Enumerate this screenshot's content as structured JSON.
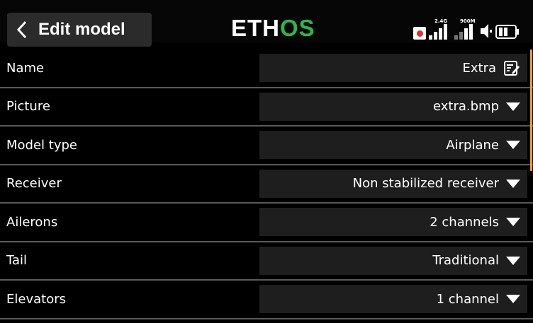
{
  "header": {
    "title": "Edit model",
    "logo_part1": "ETH",
    "logo_part2": "OS",
    "logo_part3": "",
    "signal_2g4_label": "2.4G",
    "signal_900m_label": "900M"
  },
  "colors": {
    "accent_green": "#2db64a",
    "scrollbar": "#e6a230",
    "record_red": "#e52d2d"
  },
  "rows": [
    {
      "label": "Name",
      "value": "Extra",
      "control": "edit-icon"
    },
    {
      "label": "Picture",
      "value": "extra.bmp",
      "control": "dropdown"
    },
    {
      "label": "Model type",
      "value": "Airplane",
      "control": "dropdown"
    },
    {
      "label": "Receiver",
      "value": "Non stabilized receiver",
      "control": "dropdown"
    },
    {
      "label": "Ailerons",
      "value": "2 channels",
      "control": "dropdown"
    },
    {
      "label": "Tail",
      "value": "Traditional",
      "control": "dropdown"
    },
    {
      "label": "Elevators",
      "value": "1 channel",
      "control": "dropdown"
    }
  ]
}
